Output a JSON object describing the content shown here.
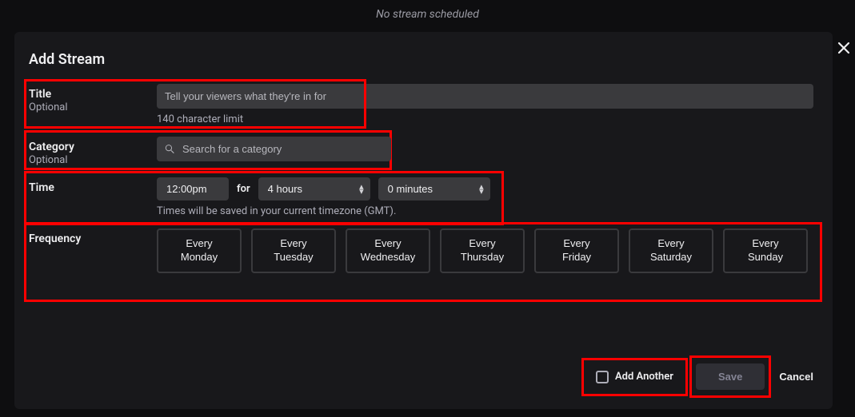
{
  "background": {
    "no_stream": "No stream scheduled"
  },
  "modal": {
    "title": "Add Stream",
    "close_aria": "Close",
    "title_section": {
      "label": "Title",
      "sublabel": "Optional",
      "placeholder": "Tell your viewers what they're in for",
      "hint": "140 character limit"
    },
    "category_section": {
      "label": "Category",
      "sublabel": "Optional",
      "placeholder": "Search for a category"
    },
    "time_section": {
      "label": "Time",
      "time_value": "12:00pm",
      "for_label": "for",
      "hours_value": "4 hours",
      "minutes_value": "0 minutes",
      "hint": "Times will be saved in your current timezone (GMT)."
    },
    "frequency_section": {
      "label": "Frequency",
      "options": [
        {
          "l1": "Every",
          "l2": "Monday"
        },
        {
          "l1": "Every",
          "l2": "Tuesday"
        },
        {
          "l1": "Every",
          "l2": "Wednesday"
        },
        {
          "l1": "Every",
          "l2": "Thursday"
        },
        {
          "l1": "Every",
          "l2": "Friday"
        },
        {
          "l1": "Every",
          "l2": "Saturday"
        },
        {
          "l1": "Every",
          "l2": "Sunday"
        }
      ]
    },
    "footer": {
      "add_another": "Add Another",
      "save": "Save",
      "cancel": "Cancel"
    }
  }
}
